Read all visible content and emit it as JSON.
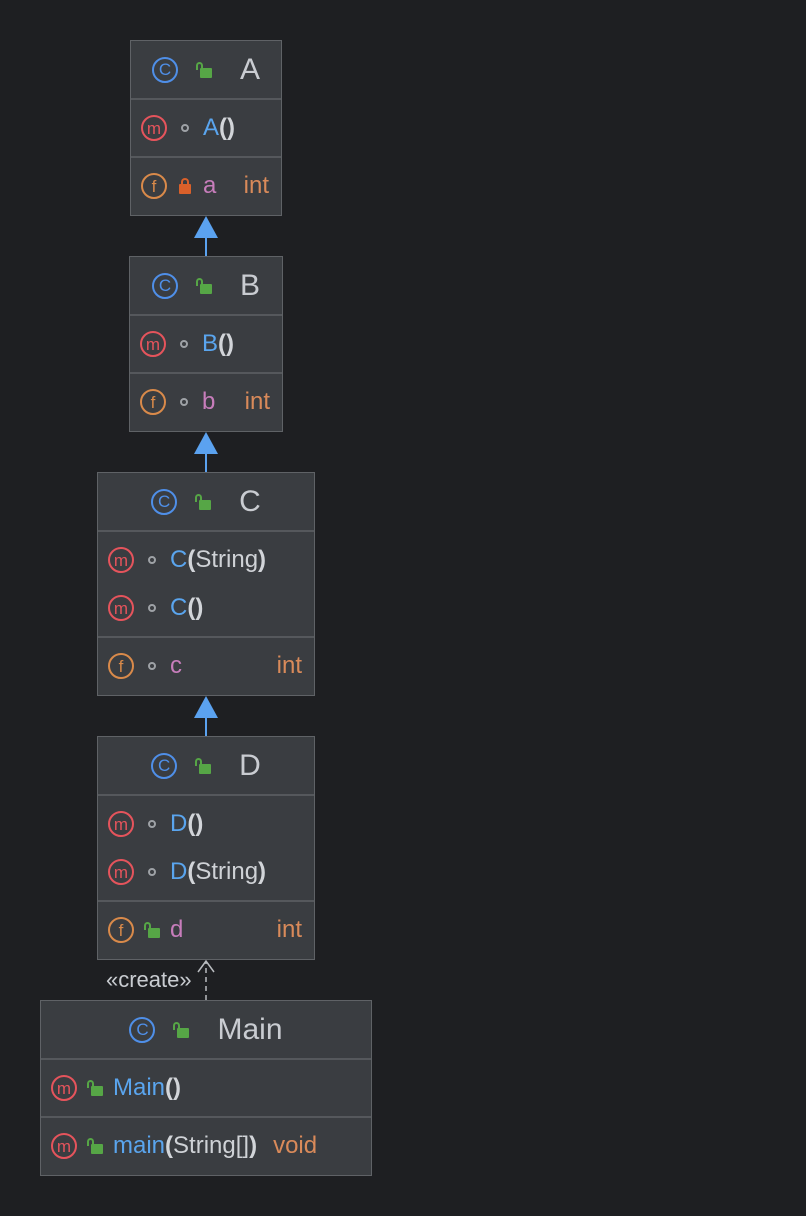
{
  "icons": {
    "class": "C",
    "method": "m",
    "field": "f"
  },
  "colors": {
    "background": "#1e1f22",
    "box": "#3a3d41",
    "border": "#5f6266",
    "arrow": "#5ba2f0",
    "method_name": "#5aa5ee",
    "field_name": "#c77dbb",
    "type": "#d98a5a",
    "class_icon": "#4f8fe8",
    "method_icon": "#e5545c",
    "field_icon": "#d98a4a",
    "public": "#56a646",
    "private": "#d9602a"
  },
  "classes": {
    "A": {
      "name": "A",
      "methods": [
        {
          "name": "A",
          "params": "",
          "visibility": "package"
        }
      ],
      "fields": [
        {
          "name": "a",
          "type": "int",
          "visibility": "private"
        }
      ]
    },
    "B": {
      "name": "B",
      "methods": [
        {
          "name": "B",
          "params": "",
          "visibility": "package"
        }
      ],
      "fields": [
        {
          "name": "b",
          "type": "int",
          "visibility": "package"
        }
      ]
    },
    "C": {
      "name": "C",
      "methods": [
        {
          "name": "C",
          "params": "String",
          "visibility": "package"
        },
        {
          "name": "C",
          "params": "",
          "visibility": "package"
        }
      ],
      "fields": [
        {
          "name": "c",
          "type": "int",
          "visibility": "package"
        }
      ]
    },
    "D": {
      "name": "D",
      "methods": [
        {
          "name": "D",
          "params": "",
          "visibility": "package"
        },
        {
          "name": "D",
          "params": "String",
          "visibility": "package"
        }
      ],
      "fields": [
        {
          "name": "d",
          "type": "int",
          "visibility": "public"
        }
      ]
    },
    "Main": {
      "name": "Main",
      "methods": [
        {
          "name": "Main",
          "params": "",
          "visibility": "public"
        },
        {
          "name": "main",
          "params": "String[]",
          "visibility": "public",
          "returns": "void"
        }
      ]
    }
  },
  "relations": {
    "create_label": "«create»"
  }
}
